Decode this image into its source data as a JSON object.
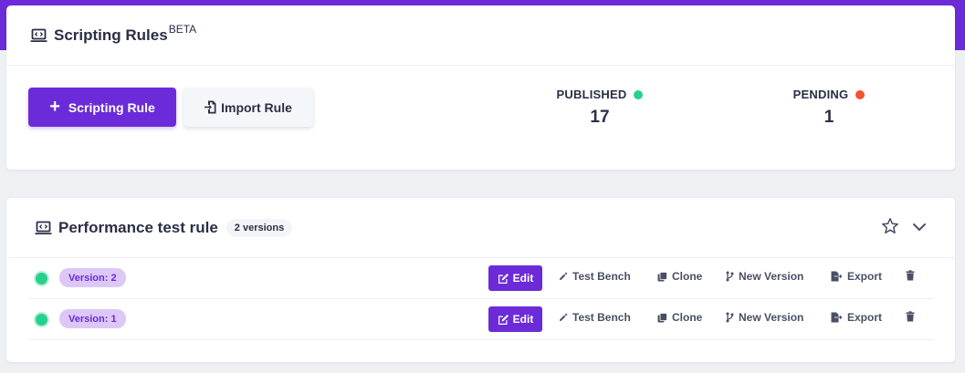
{
  "colors": {
    "accent": "#6c2bd9",
    "published": "#27d08e",
    "pending": "#f0542d",
    "version_badge_bg": "#dcc8f6"
  },
  "header": {
    "title": "Scripting Rules",
    "title_sup": "BETA",
    "icon": "laptop-code-icon"
  },
  "actions": {
    "add_rule_label": "Scripting Rule",
    "import_rule_label": "Import Rule"
  },
  "stats": {
    "published": {
      "label": "PUBLISHED",
      "value": "17"
    },
    "pending": {
      "label": "PENDING",
      "value": "1"
    }
  },
  "rule": {
    "name": "Performance test rule",
    "versions_badge": "2 versions",
    "versions": [
      {
        "label": "Version: 2",
        "status": "published"
      },
      {
        "label": "Version: 1",
        "status": "published"
      }
    ]
  },
  "row_actions": {
    "edit": "Edit",
    "test_bench": "Test Bench",
    "clone": "Clone",
    "new_version": "New Version",
    "export": "Export"
  }
}
